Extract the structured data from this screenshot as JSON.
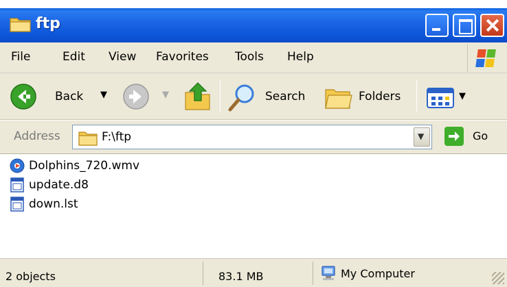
{
  "window": {
    "title": "ftp"
  },
  "menu": [
    "File",
    "Edit",
    "View",
    "Favorites",
    "Tools",
    "Help"
  ],
  "toolbar": {
    "back_label": "Back",
    "search_label": "Search",
    "folders_label": "Folders"
  },
  "address": {
    "label": "Address",
    "value": "F:\\ftp",
    "go_label": "Go"
  },
  "files": [
    {
      "name": "Dolphins_720.wmv",
      "icon": "media-file-icon"
    },
    {
      "name": "update.d8",
      "icon": "generic-file-icon"
    },
    {
      "name": "down.lst",
      "icon": "generic-file-icon"
    }
  ],
  "status": {
    "objects": "2 objects",
    "size": "83.1 MB",
    "location": "My Computer"
  },
  "colors": {
    "titlebar": "#1c66e6",
    "chrome": "#ece9d8",
    "go": "#3fae2a",
    "close": "#d2492a"
  }
}
